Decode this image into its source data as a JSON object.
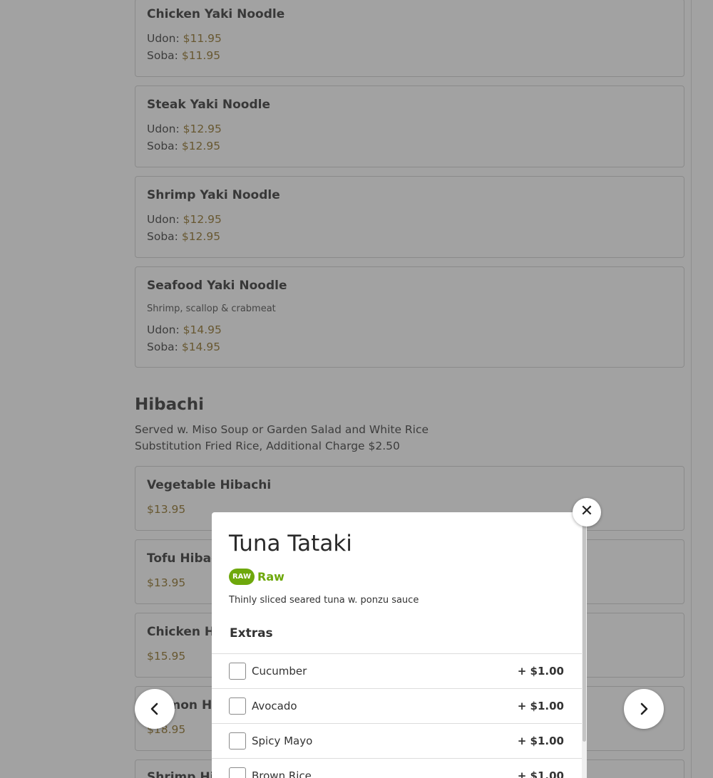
{
  "noodle_items": [
    {
      "name": "Chicken Yaki Noodle",
      "udon_label": "Udon:",
      "udon_price": "$11.95",
      "soba_label": "Soba:",
      "soba_price": "$11.95"
    },
    {
      "name": "Steak Yaki Noodle",
      "udon_label": "Udon:",
      "udon_price": "$12.95",
      "soba_label": "Soba:",
      "soba_price": "$12.95"
    },
    {
      "name": "Shrimp Yaki Noodle",
      "udon_label": "Udon:",
      "udon_price": "$12.95",
      "soba_label": "Soba:",
      "soba_price": "$12.95"
    },
    {
      "name": "Seafood Yaki Noodle",
      "desc": "Shrimp, scallop & crabmeat",
      "udon_label": "Udon:",
      "udon_price": "$14.95",
      "soba_label": "Soba:",
      "soba_price": "$14.95"
    }
  ],
  "hibachi_section": {
    "title": "Hibachi",
    "note_1": "Served w. Miso Soup or Garden Salad and White Rice",
    "note_2": "Substitution Fried Rice, Additional Charge $2.50"
  },
  "hibachi_items": [
    {
      "name": "Vegetable Hibachi",
      "price": "$13.95"
    },
    {
      "name": "Tofu Hibachi",
      "price": "$13.95"
    },
    {
      "name": "Chicken Hibachi",
      "price": "$15.95"
    },
    {
      "name": "Salmon Hibachi",
      "price": "$18.95"
    },
    {
      "name": "Shrimp Hibachi",
      "price": ""
    }
  ],
  "modal": {
    "title": "Tuna Tataki",
    "badge": "RAW",
    "badge_label": "Raw",
    "description": "Thinly sliced seared tuna w. ponzu sauce",
    "extras_title": "Extras",
    "options": [
      {
        "label": "Cucumber",
        "price": "+ $1.00"
      },
      {
        "label": "Avocado",
        "price": "+ $1.00"
      },
      {
        "label": "Spicy Mayo",
        "price": "+ $1.00"
      },
      {
        "label": "Brown Rice",
        "price": "+ $1.00"
      }
    ],
    "close_symbol": "✕"
  },
  "icons": {
    "close": "close-icon",
    "prev": "chevron-left-icon",
    "next": "chevron-right-icon"
  },
  "colors": {
    "price": "#8a6a1c",
    "raw_green": "#6ea80c",
    "overlay": "rgba(70,70,70,0.5)"
  }
}
